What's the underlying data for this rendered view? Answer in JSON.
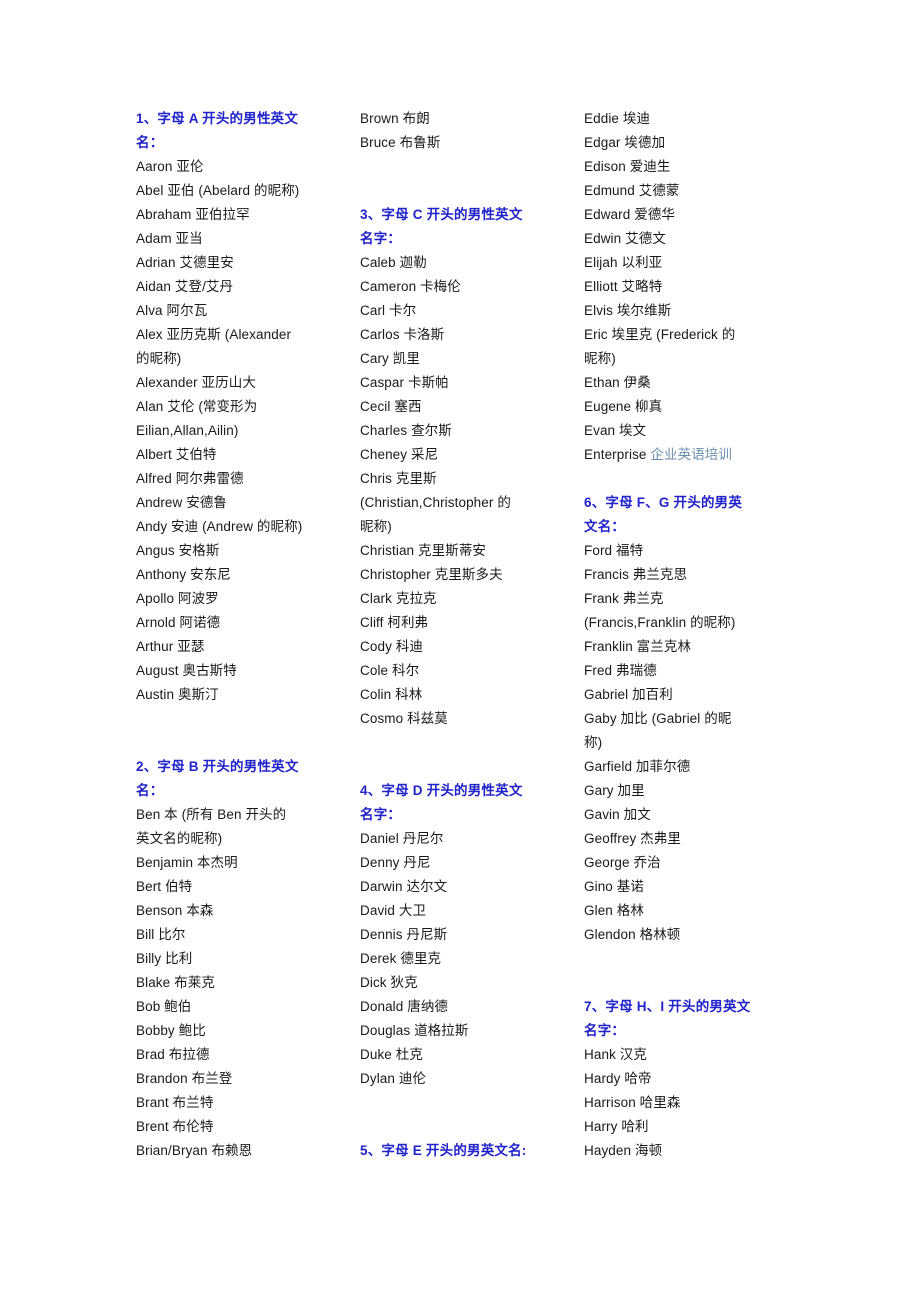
{
  "document": {
    "title": "男性英文名列表",
    "background_color": "#ffffff",
    "heading_color": "#2222cc",
    "body_text_color": "#1a1a1a",
    "link_color": "#6b8fae"
  },
  "columns": [
    {
      "name": "column-1",
      "lines": [
        {
          "text": "1、字母 A 开头的男性英文",
          "style": "heading"
        },
        {
          "text": "名：",
          "style": "heading"
        },
        {
          "text": "Aaron 亚伦",
          "style": "entry"
        },
        {
          "text": "Abel 亚伯 (Abelard 的昵称)",
          "style": "entry"
        },
        {
          "text": "Abraham 亚伯拉罕",
          "style": "entry"
        },
        {
          "text": "Adam 亚当",
          "style": "entry"
        },
        {
          "text": "Adrian 艾德里安",
          "style": "entry"
        },
        {
          "text": "Aidan 艾登/艾丹",
          "style": "entry"
        },
        {
          "text": "Alva 阿尔瓦",
          "style": "entry"
        },
        {
          "text": "Alex 亚历克斯 (Alexander",
          "style": "entry"
        },
        {
          "text": "的昵称)",
          "style": "entry"
        },
        {
          "text": "Alexander 亚历山大",
          "style": "entry"
        },
        {
          "text": "Alan 艾伦 (常变形为",
          "style": "entry"
        },
        {
          "text": "Eilian,Allan,Ailin)",
          "style": "entry"
        },
        {
          "text": "Albert 艾伯特",
          "style": "entry"
        },
        {
          "text": "Alfred 阿尔弗雷德",
          "style": "entry"
        },
        {
          "text": "Andrew 安德鲁",
          "style": "entry"
        },
        {
          "text": "Andy 安迪 (Andrew 的昵称)",
          "style": "entry"
        },
        {
          "text": "Angus 安格斯",
          "style": "entry"
        },
        {
          "text": "Anthony 安东尼",
          "style": "entry"
        },
        {
          "text": "Apollo 阿波罗",
          "style": "entry"
        },
        {
          "text": "Arnold 阿诺德",
          "style": "entry"
        },
        {
          "text": "Arthur 亚瑟",
          "style": "entry"
        },
        {
          "text": "August 奥古斯特",
          "style": "entry"
        },
        {
          "text": "Austin 奥斯汀",
          "style": "entry"
        },
        {
          "text": "",
          "style": "blank"
        },
        {
          "text": "",
          "style": "blank"
        },
        {
          "text": "2、字母 B 开头的男性英文",
          "style": "heading"
        },
        {
          "text": "名：",
          "style": "heading"
        },
        {
          "text": "Ben 本 (所有 Ben 开头的",
          "style": "entry"
        },
        {
          "text": "英文名的昵称)",
          "style": "entry"
        },
        {
          "text": "Benjamin 本杰明",
          "style": "entry"
        },
        {
          "text": "Bert 伯特",
          "style": "entry"
        },
        {
          "text": "Benson 本森",
          "style": "entry"
        },
        {
          "text": "Bill 比尔",
          "style": "entry"
        },
        {
          "text": "Billy 比利",
          "style": "entry"
        },
        {
          "text": "Blake 布莱克",
          "style": "entry"
        },
        {
          "text": "Bob 鲍伯",
          "style": "entry"
        },
        {
          "text": "Bobby 鲍比",
          "style": "entry"
        },
        {
          "text": "Brad 布拉德",
          "style": "entry"
        },
        {
          "text": "Brandon 布兰登",
          "style": "entry"
        },
        {
          "text": "Brant 布兰特",
          "style": "entry"
        },
        {
          "text": "Brent 布伦特",
          "style": "entry"
        },
        {
          "text": "Brian/Bryan 布赖恩",
          "style": "entry"
        }
      ]
    },
    {
      "name": "column-2",
      "lines": [
        {
          "text": "Brown 布朗",
          "style": "entry"
        },
        {
          "text": "Bruce 布鲁斯",
          "style": "entry"
        },
        {
          "text": "",
          "style": "blank"
        },
        {
          "text": "",
          "style": "blank"
        },
        {
          "text": "3、字母 C 开头的男性英文",
          "style": "heading"
        },
        {
          "text": "名字：",
          "style": "heading"
        },
        {
          "text": "Caleb 迦勒",
          "style": "entry"
        },
        {
          "text": "Cameron 卡梅伦",
          "style": "entry"
        },
        {
          "text": "Carl 卡尔",
          "style": "entry"
        },
        {
          "text": "Carlos 卡洛斯",
          "style": "entry"
        },
        {
          "text": "Cary 凯里",
          "style": "entry"
        },
        {
          "text": "Caspar 卡斯帕",
          "style": "entry"
        },
        {
          "text": "Cecil 塞西",
          "style": "entry"
        },
        {
          "text": "Charles 查尔斯",
          "style": "entry"
        },
        {
          "text": "Cheney 采尼",
          "style": "entry"
        },
        {
          "text": "Chris 克里斯",
          "style": "entry"
        },
        {
          "text": " (Christian,Christopher 的",
          "style": "entry"
        },
        {
          "text": "昵称)",
          "style": "entry"
        },
        {
          "text": "Christian 克里斯蒂安",
          "style": "entry"
        },
        {
          "text": "Christopher 克里斯多夫",
          "style": "entry"
        },
        {
          "text": "Clark 克拉克",
          "style": "entry"
        },
        {
          "text": "Cliff 柯利弗",
          "style": "entry"
        },
        {
          "text": "Cody 科迪",
          "style": "entry"
        },
        {
          "text": "Cole 科尔",
          "style": "entry"
        },
        {
          "text": "Colin 科林",
          "style": "entry"
        },
        {
          "text": "Cosmo 科兹莫",
          "style": "entry"
        },
        {
          "text": "",
          "style": "blank"
        },
        {
          "text": "",
          "style": "blank"
        },
        {
          "text": "4、字母 D 开头的男性英文",
          "style": "heading"
        },
        {
          "text": "名字：",
          "style": "heading"
        },
        {
          "text": "Daniel 丹尼尔",
          "style": "entry"
        },
        {
          "text": "Denny 丹尼",
          "style": "entry"
        },
        {
          "text": "Darwin 达尔文",
          "style": "entry"
        },
        {
          "text": "David 大卫",
          "style": "entry"
        },
        {
          "text": "Dennis 丹尼斯",
          "style": "entry"
        },
        {
          "text": "Derek 德里克",
          "style": "entry"
        },
        {
          "text": "Dick 狄克",
          "style": "entry"
        },
        {
          "text": "Donald 唐纳德",
          "style": "entry"
        },
        {
          "text": "Douglas 道格拉斯",
          "style": "entry"
        },
        {
          "text": "Duke 杜克",
          "style": "entry"
        },
        {
          "text": "Dylan 迪伦",
          "style": "entry"
        },
        {
          "text": "",
          "style": "blank"
        },
        {
          "text": "",
          "style": "blank"
        },
        {
          "text": "5、字母 E 开头的男英文名:",
          "style": "heading"
        }
      ]
    },
    {
      "name": "column-3",
      "lines": [
        {
          "text": "Eddie 埃迪",
          "style": "entry"
        },
        {
          "text": "Edgar 埃德加",
          "style": "entry"
        },
        {
          "text": "Edison 爱迪生",
          "style": "entry"
        },
        {
          "text": "Edmund 艾德蒙",
          "style": "entry"
        },
        {
          "text": "Edward 爱德华",
          "style": "entry"
        },
        {
          "text": "Edwin 艾德文",
          "style": "entry"
        },
        {
          "text": "Elijah 以利亚",
          "style": "entry"
        },
        {
          "text": "Elliott 艾略特",
          "style": "entry"
        },
        {
          "text": "Elvis 埃尔维斯",
          "style": "entry"
        },
        {
          "text": "Eric 埃里克 (Frederick 的",
          "style": "entry"
        },
        {
          "text": "昵称)",
          "style": "entry"
        },
        {
          "text": "Ethan 伊桑",
          "style": "entry"
        },
        {
          "text": "Eugene 柳真",
          "style": "entry"
        },
        {
          "text": "Evan 埃文",
          "style": "entry"
        },
        {
          "text": "Enterprise 企业英语培训",
          "style": "link",
          "plain": "Enterprise ",
          "linked": "企业英语培训"
        },
        {
          "text": "",
          "style": "blank"
        },
        {
          "text": "6、字母 F、G 开头的男英",
          "style": "heading"
        },
        {
          "text": "文名：",
          "style": "heading"
        },
        {
          "text": "Ford 福特",
          "style": "entry"
        },
        {
          "text": "Francis 弗兰克思",
          "style": "entry"
        },
        {
          "text": "Frank 弗兰克",
          "style": "entry"
        },
        {
          "text": " (Francis,Franklin 的昵称)",
          "style": "entry"
        },
        {
          "text": "Franklin 富兰克林",
          "style": "entry"
        },
        {
          "text": "Fred 弗瑞德",
          "style": "entry"
        },
        {
          "text": "Gabriel 加百利",
          "style": "entry"
        },
        {
          "text": "Gaby 加比 (Gabriel 的昵",
          "style": "entry"
        },
        {
          "text": "称)",
          "style": "entry"
        },
        {
          "text": "Garfield 加菲尔德",
          "style": "entry"
        },
        {
          "text": "Gary 加里",
          "style": "entry"
        },
        {
          "text": "Gavin 加文",
          "style": "entry"
        },
        {
          "text": "Geoffrey 杰弗里",
          "style": "entry"
        },
        {
          "text": "George 乔治",
          "style": "entry"
        },
        {
          "text": "Gino 基诺",
          "style": "entry"
        },
        {
          "text": "Glen 格林",
          "style": "entry"
        },
        {
          "text": "Glendon 格林顿",
          "style": "entry"
        },
        {
          "text": "",
          "style": "blank"
        },
        {
          "text": "",
          "style": "blank"
        },
        {
          "text": "7、字母 H、I 开头的男英文",
          "style": "heading"
        },
        {
          "text": "名字：",
          "style": "heading"
        },
        {
          "text": "Hank 汉克",
          "style": "entry"
        },
        {
          "text": "Hardy 哈帝",
          "style": "entry"
        },
        {
          "text": "Harrison 哈里森",
          "style": "entry"
        },
        {
          "text": "Harry 哈利",
          "style": "entry"
        },
        {
          "text": "Hayden 海顿",
          "style": "entry"
        }
      ]
    }
  ]
}
